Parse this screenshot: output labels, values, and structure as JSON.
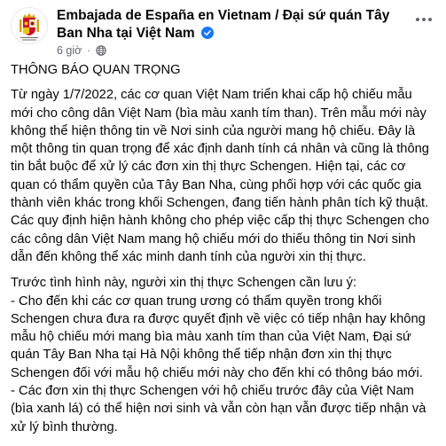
{
  "post": {
    "author": "Embajada de España en Vietnam / Đại sứ quán Tây Ban Nha tại Việt Nam",
    "timestamp": "6 giờ",
    "separator": "·",
    "avatar_icon": "spain-coat-of-arms-icon",
    "verified_icon": "verified-badge-icon",
    "audience_icon": "globe-icon",
    "menu_icon": "more-options-icon",
    "colors": {
      "verified": "#1877f2",
      "meta": "#65676b",
      "text": "#050505"
    }
  },
  "content": {
    "heading": "THÔNG BÁO QUAN TRỌNG",
    "paragraph1": "Từ ngày 1/7/2022, các cơ quan Việt Nam triển khai cấp hộ chiếu mẫu mới cho công dân Việt Nam (bìa màu xanh tím than). Trên mẫu mới này không thể hiện thông tin về Nơi sinh của người mang hộ chiếu. Đây là một thông tin quan trọng để xác định danh tính cá nhân và cũng là thông tin bắt buộc để xử lý các đơn xin thị thực Schengen. Hiện tại, các cơ quan có thẩm quyền của Tây Ban Nha, cùng phối hợp với các quốc gia thành viên khác trong khối Schengen, đang tiến hành phân tích kỹ thuật. Các quy định hiện hành không cho phép việc cấp thị thực Schengen cho các công dân Việt Nam mang hộ chiếu mới do thiếu thông tin Nơi sinh dẫn đến không thể xác minh danh tính của người xin thị thực.",
    "paragraph2_intro": "Trước tình hình này, người xin thị thực Schengen cần lưu ý:",
    "bullet1": "- Cho đến khi các cơ quan trung ương có thẩm quyền trong khối Schengen chưa đưa ra được quyết định về việc có tiếp nhận hay không mẫu hộ chiếu mới mang bìa màu xanh tím than của Việt Nam, Đại sứ quán Tây Ban Nha tại Hà Nội không thể tiếp nhận đơn xin thị thực Schengen đối với mẫu hộ chiếu mới này cho đến khi có thông báo mới.",
    "bullet2": "- Các đơn xin thị thực Schengen với hộ chiếu trước đây của Việt Nam (bìa xanh lá) có thể hiện nơi sinh và vẫn còn hạn vẫn được tiếp nhận và xử lý bình thường."
  }
}
